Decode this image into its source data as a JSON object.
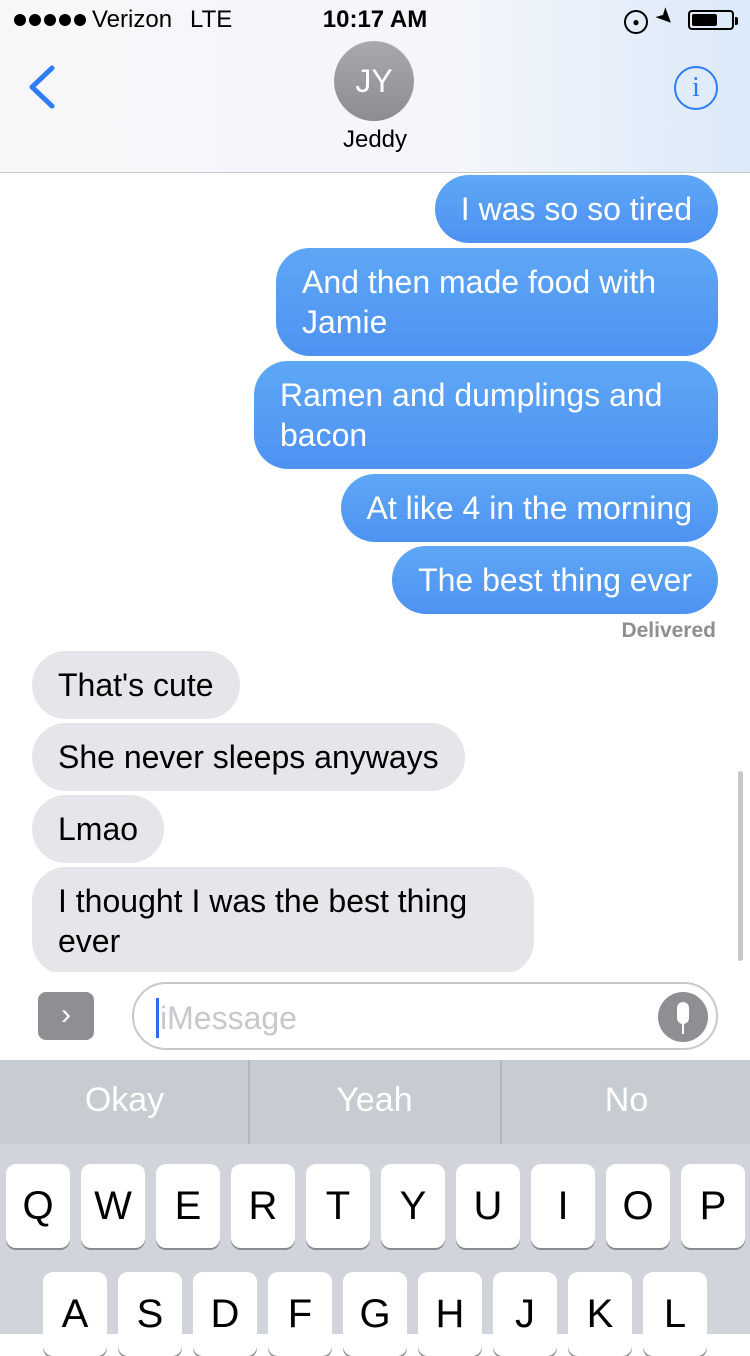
{
  "status_bar": {
    "carrier": "Verizon",
    "network": "LTE",
    "time": "10:17 AM",
    "battery_level": 0.6
  },
  "header": {
    "avatar_initials": "JY",
    "contact_name": "Jeddy",
    "back_icon": "chevron-left-icon",
    "info_icon": "info-icon"
  },
  "messages": [
    {
      "direction": "sent",
      "text": "I was so so tired"
    },
    {
      "direction": "sent",
      "text": "And then made food with Jamie"
    },
    {
      "direction": "sent",
      "text": "Ramen and dumplings and bacon"
    },
    {
      "direction": "sent",
      "text": "At like 4 in the morning"
    },
    {
      "direction": "sent",
      "text": "The best thing ever"
    },
    {
      "direction": "received",
      "text": "That's cute"
    },
    {
      "direction": "received",
      "text": "She never sleeps anyways"
    },
    {
      "direction": "received",
      "text": "Lmao"
    },
    {
      "direction": "received",
      "text": "I thought I was the best thing ever"
    }
  ],
  "delivery_status": "Delivered",
  "composer": {
    "placeholder": "iMessage",
    "expand_icon": "chevron-right-icon",
    "mic_icon": "microphone-icon"
  },
  "predictions": [
    "Okay",
    "Yeah",
    "No"
  ],
  "keyboard": {
    "row1": [
      "Q",
      "W",
      "E",
      "R",
      "T",
      "Y",
      "U",
      "I",
      "O",
      "P"
    ],
    "row2": [
      "A",
      "S",
      "D",
      "F",
      "G",
      "H",
      "J",
      "K",
      "L"
    ]
  },
  "colors": {
    "sent_bubble": "#4e92f2",
    "received_bubble": "#e5e5ea",
    "accent": "#2e7cf6"
  }
}
